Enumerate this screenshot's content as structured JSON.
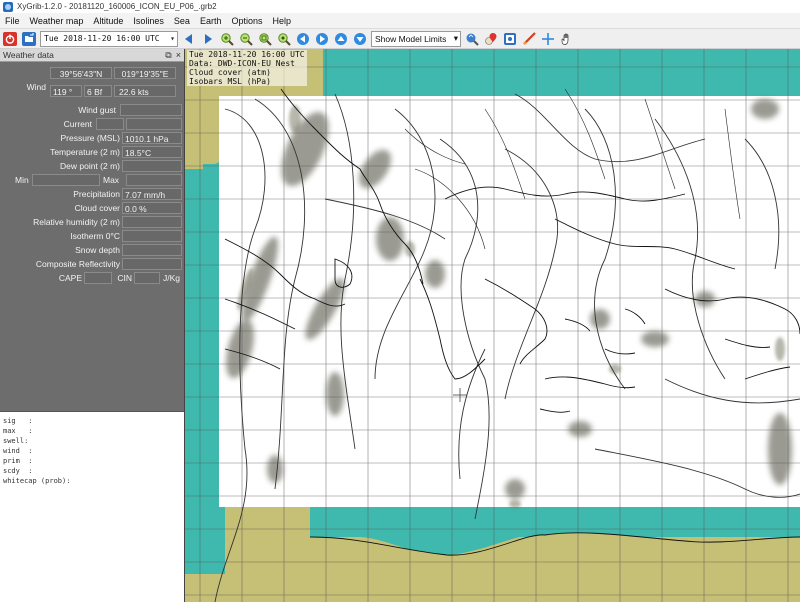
{
  "window": {
    "title": "XyGrib-1.2.0 - 20181120_160006_ICON_EU_P06_.grb2"
  },
  "menu": [
    "File",
    "Weather map",
    "Altitude",
    "Isolines",
    "Sea",
    "Earth",
    "Options",
    "Help"
  ],
  "toolbar": {
    "date_value": "Tue 2018-11-20 16:00 UTC",
    "model_limits_label": "Show Model Limits"
  },
  "panel": {
    "title": "Weather data",
    "lat": "39°56'43\"N",
    "lon": "019°19'35\"E",
    "wind_label": "Wind",
    "wind_dir": "119 °",
    "wind_bf": "6 Bf",
    "wind_kts": "22.6 kts",
    "wind_gust_label": "Wind gust",
    "current_label": "Current",
    "pressure_label": "Pressure (MSL)",
    "pressure_value": "1010.1 hPa",
    "temperature_label": "Temperature (2 m)",
    "temperature_value": "18.5°C",
    "dewpoint_label": "Dew point (2 m)",
    "min_label": "Min",
    "max_label": "Max",
    "precip_label": "Precipitation",
    "precip_value": "7.07 mm/h",
    "cloud_label": "Cloud cover",
    "cloud_value": "0.0 %",
    "rh_label": "Relative humidity (2 m)",
    "isotherm_label": "Isotherm 0°C",
    "snow_label": "Snow depth",
    "reflectivity_label": "Composite Reflectivity",
    "cape_label": "CAPE",
    "cin_label": "CIN",
    "jkg_label": "J/Kg"
  },
  "console_lines": [
    "sig   :",
    "max   :",
    "swell:",
    "wind  :",
    "prim  :",
    "scdy  :",
    "whitecap (prob):"
  ],
  "map_info": {
    "line1": "Tue 2018-11-20 16:00 UTC",
    "line2": "Data: DWD-ICON-EU Nest",
    "line3": "Cloud cover (atm)",
    "line4": "Isobars MSL (hPa)"
  },
  "colors": {
    "land": "#c6bf76",
    "sea": "#3fb9ae",
    "panel": "#6d6d6d",
    "cloud_free": "#ffffff"
  }
}
